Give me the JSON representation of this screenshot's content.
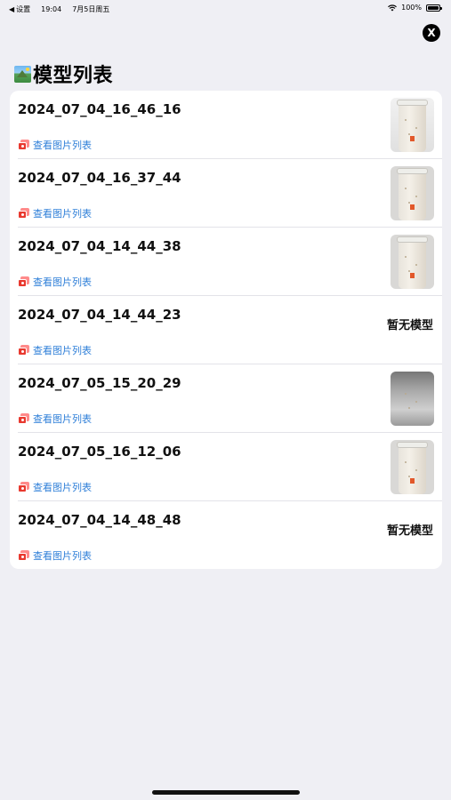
{
  "status_bar": {
    "back_label": "设置",
    "time": "19:04",
    "date": "7月5日周五",
    "battery": "100%"
  },
  "close_button": {
    "label": "X"
  },
  "header": {
    "title": "模型列表"
  },
  "rows": [
    {
      "title": "2024_07_04_16_46_16",
      "link": "查看图片列表",
      "has_model": true,
      "thumb": "cup-light"
    },
    {
      "title": "2024_07_04_16_37_44",
      "link": "查看图片列表",
      "has_model": true,
      "thumb": "cup"
    },
    {
      "title": "2024_07_04_14_44_38",
      "link": "查看图片列表",
      "has_model": true,
      "thumb": "cup"
    },
    {
      "title": "2024_07_04_14_44_23",
      "link": "查看图片列表",
      "has_model": false,
      "no_model_text": "暂无模型"
    },
    {
      "title": "2024_07_05_15_20_29",
      "link": "查看图片列表",
      "has_model": true,
      "thumb": "dark"
    },
    {
      "title": "2024_07_05_16_12_06",
      "link": "查看图片列表",
      "has_model": true,
      "thumb": "cup"
    },
    {
      "title": "2024_07_04_14_48_48",
      "link": "查看图片列表",
      "has_model": false,
      "no_model_text": "暂无模型"
    }
  ]
}
